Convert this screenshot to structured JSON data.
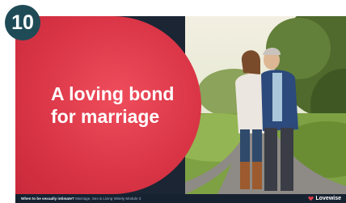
{
  "badge": {
    "number": "10"
  },
  "slide": {
    "headline_line1": "A loving bond",
    "headline_line2": "for marriage",
    "footer_question": "When to be sexually intimate?",
    "footer_course": "Marriage, Sex & Living Wisely Module 3",
    "brand": "Lovewise"
  },
  "colors": {
    "panel_red": "#d83445",
    "badge_teal": "#1f4b57",
    "footer_navy": "#172231"
  },
  "icons": [
    "lovewise-logo-icon"
  ]
}
